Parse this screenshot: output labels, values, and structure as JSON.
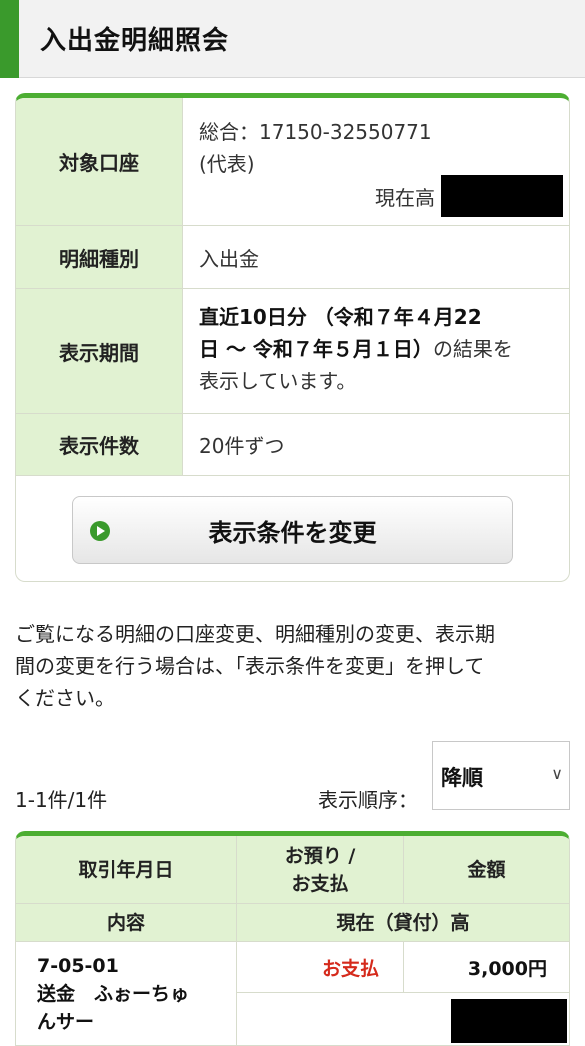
{
  "page": {
    "title": "入出金明細照会"
  },
  "conditions": {
    "account": {
      "label": "対象口座",
      "line1": "総合：17150-32550771",
      "line2": "(代表)",
      "balance_label": "現在高"
    },
    "type": {
      "label": "明細種別",
      "value": "入出金"
    },
    "period": {
      "label": "表示期間",
      "bold_line1": "直近10日分 （令和７年４月22",
      "bold_line2": "日 ～ 令和７年５月１日）",
      "normal_tail": "の結果を",
      "line3": "表示しています。"
    },
    "count": {
      "label": "表示件数",
      "value": "20件ずつ"
    },
    "change_button": "表示条件を変更"
  },
  "description": {
    "line1": "ご覧になる明細の口座変更、明細種別の変更、表示期",
    "line2": "間の変更を行う場合は、「表示条件を変更」を押して",
    "line3": "ください。"
  },
  "results": {
    "count_text": "1-1件/1件",
    "order_label": "表示順序：",
    "order_value": "降順",
    "order_chevron": "∨"
  },
  "table": {
    "headers": {
      "date": "取引年月日",
      "type_line1": "お預り /",
      "type_line2": "お支払",
      "amount": "金額",
      "content": "内容",
      "balance": "現在（貸付）高"
    },
    "rows": [
      {
        "date": "7-05-01",
        "content_line1": "送金　ふぉーちゅ",
        "content_line2": "んサー",
        "type": "お支払",
        "amount": "3,000円"
      }
    ]
  },
  "colors": {
    "accent_green": "#4cae32",
    "header_fill": "#e1f2d2",
    "payout_red": "#d52a1c"
  }
}
